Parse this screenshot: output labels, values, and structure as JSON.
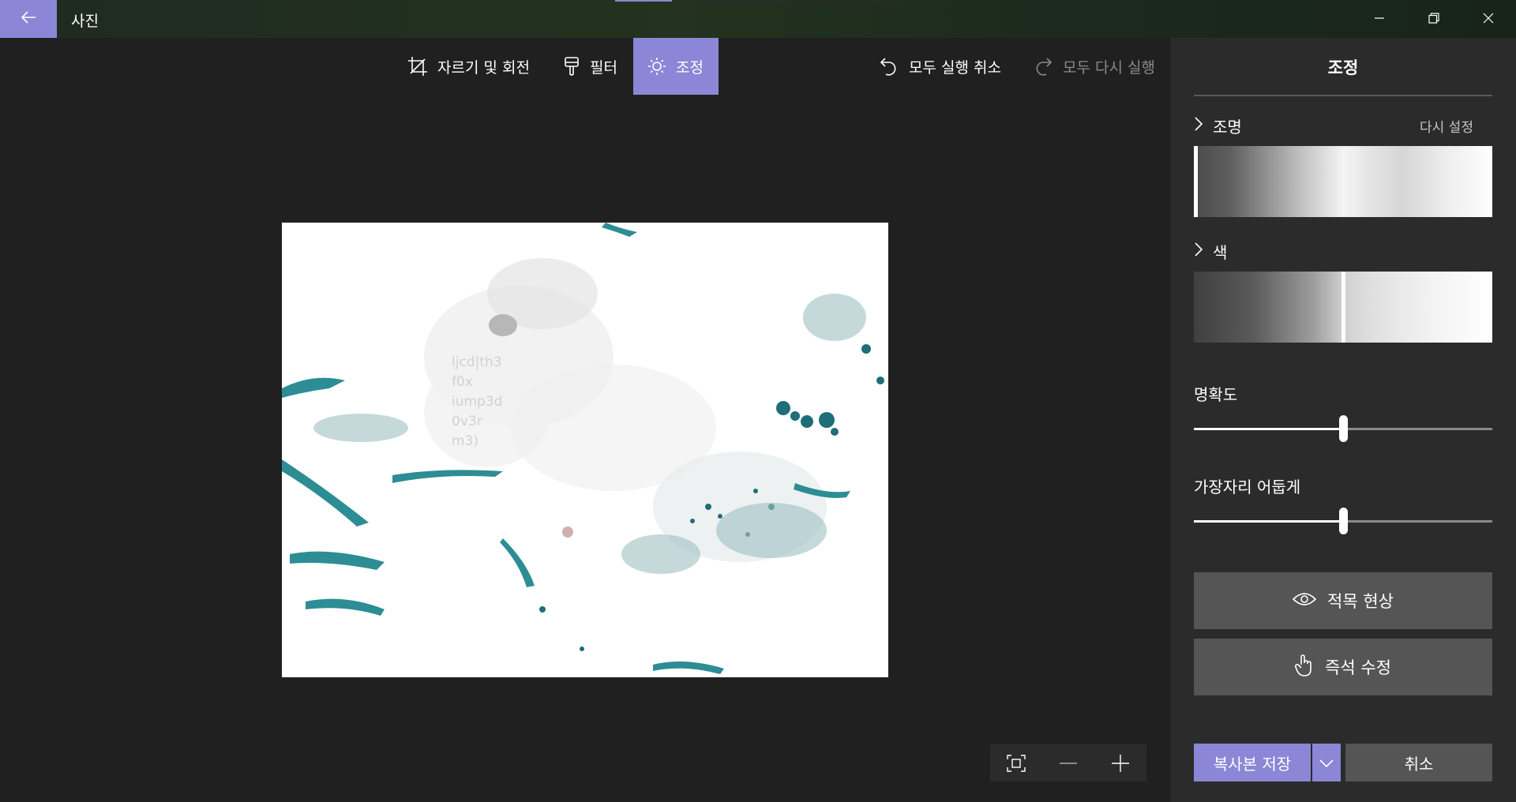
{
  "colors": {
    "accent": "#8b86d6",
    "background": "#202020",
    "panel": "#2b2b2b",
    "button": "#555555"
  },
  "titlebar": {
    "app_title": "사진",
    "back_icon": "arrow-left-icon",
    "window_controls": [
      "minimize-icon",
      "restore-icon",
      "close-icon"
    ]
  },
  "toolbar": {
    "crop_rotate": {
      "icon": "crop-icon",
      "label": "자르기 및 회전"
    },
    "filter": {
      "icon": "brush-icon",
      "label": "필터"
    },
    "adjust": {
      "icon": "sun-icon",
      "label": "조정",
      "active": true
    },
    "undo_all": {
      "icon": "undo-icon",
      "label": "모두 실행 취소"
    },
    "redo_all": {
      "icon": "redo-icon",
      "label": "모두 다시 실행",
      "enabled": false
    }
  },
  "photo": {
    "watermark_lines": [
      "ljcd|th3",
      "f0x",
      "iump3d",
      "0v3r",
      "m3)"
    ]
  },
  "zoom": {
    "icons": [
      "fit-screen-icon",
      "zoom-out-icon",
      "zoom-in-icon"
    ]
  },
  "panel": {
    "title": "조정",
    "light": {
      "label": "조명",
      "reset_label": "다시 설정",
      "marker_fraction": 0.0
    },
    "color": {
      "label": "색",
      "marker_fraction": 0.5
    },
    "clarity": {
      "label": "명확도",
      "value_fraction": 0.5
    },
    "vignette": {
      "label": "가장자리 어둡게",
      "value_fraction": 0.5
    },
    "red_eye": {
      "icon": "eye-icon",
      "label": "적목 현상"
    },
    "spot_fix": {
      "icon": "touch-icon",
      "label": "즉석 수정"
    },
    "save_copy": {
      "label": "복사본 저장"
    },
    "cancel": {
      "label": "취소"
    }
  }
}
